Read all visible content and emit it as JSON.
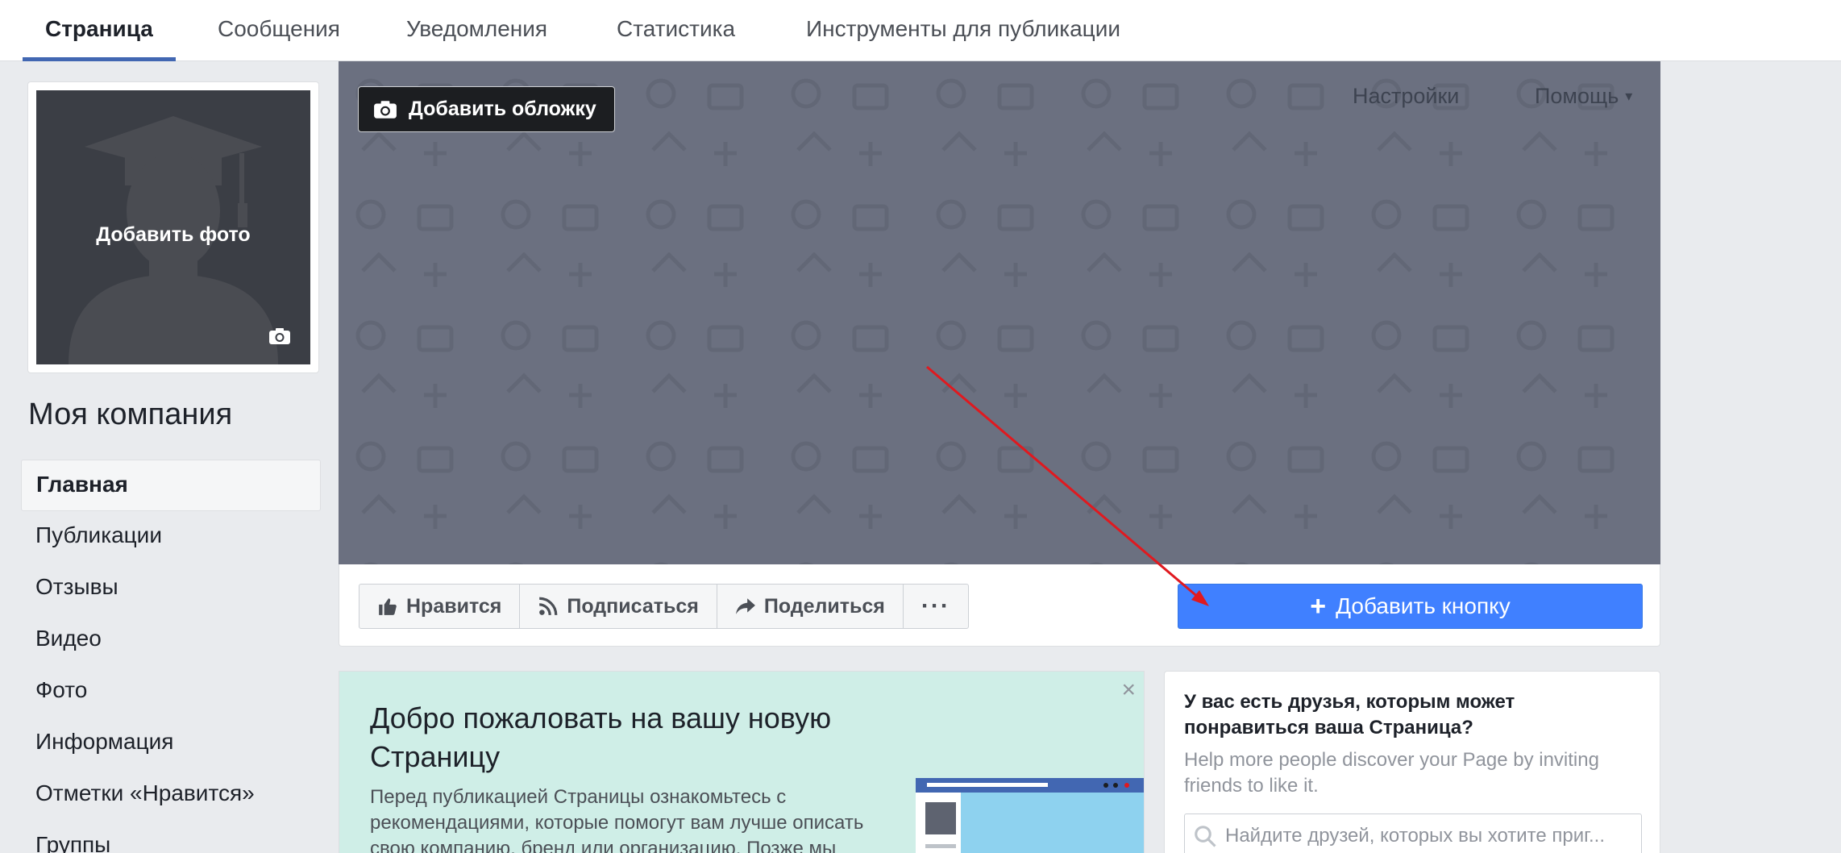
{
  "tabs": [
    {
      "label": "Страница",
      "active": true
    },
    {
      "label": "Сообщения"
    },
    {
      "label": "Уведомления"
    },
    {
      "label": "Статистика"
    },
    {
      "label": "Инструменты для публикации"
    }
  ],
  "profile": {
    "add_photo_label": "Добавить фото",
    "camera_icon": "camera-icon"
  },
  "company_name": "Моя компания",
  "nav": {
    "items": [
      {
        "label": "Главная",
        "active": true
      },
      {
        "label": "Публикации"
      },
      {
        "label": "Отзывы"
      },
      {
        "label": "Видео"
      },
      {
        "label": "Фото"
      },
      {
        "label": "Информация"
      },
      {
        "label": "Отметки «Нравится»"
      },
      {
        "label": "Группы"
      }
    ]
  },
  "cover": {
    "add_cover_label": "Добавить обложку",
    "settings_label": "Настройки",
    "help_label": "Помощь",
    "help_caret": "▾"
  },
  "actions": {
    "like_label": "Нравится",
    "follow_label": "Подписаться",
    "share_label": "Поделиться",
    "more_label": "···",
    "add_button_label": "Добавить кнопку",
    "add_button_plus": "+"
  },
  "welcome": {
    "close": "×",
    "title": "Добро пожаловать на вашу новую Страницу",
    "body": "Перед публикацией Страницы ознакомьтесь с рекомендациями, которые помогут вам лучше описать свою компанию, бренд или организацию. Позже мы"
  },
  "invite": {
    "title": "У вас есть друзья, которым может понравиться ваша Страница?",
    "subtitle": "Help more people discover your Page by inviting friends to like it.",
    "search_placeholder": "Найдите друзей, которых вы хотите приг..."
  },
  "colors": {
    "accent": "#4267b2",
    "primary_button": "#4080ff",
    "cover": "#6b7080",
    "welcome_bg": "#cfeee7",
    "annotation_arrow": "#e0191f"
  }
}
